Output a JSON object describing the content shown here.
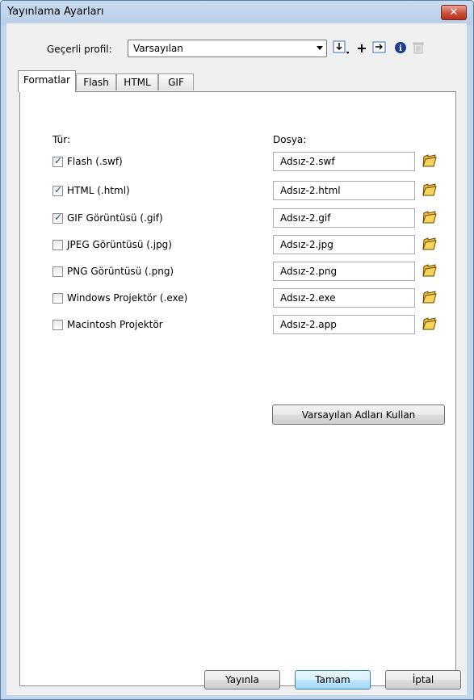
{
  "window": {
    "title": "Yayınlama Ayarları"
  },
  "profile": {
    "label": "Geçerli profil:",
    "selected": "Varsayılan",
    "toolbar_icons": [
      "import-export-icon",
      "add-icon",
      "duplicate-icon",
      "info-icon",
      "delete-icon"
    ]
  },
  "tabs": [
    {
      "label": "Formatlar",
      "active": true
    },
    {
      "label": "Flash",
      "active": false
    },
    {
      "label": "HTML",
      "active": false
    },
    {
      "label": "GIF",
      "active": false
    }
  ],
  "formats": {
    "type_header": "Tür:",
    "file_header": "Dosya:",
    "rows": [
      {
        "label": "Flash  (.swf)",
        "checked": true,
        "file": "Adsız-2.swf"
      },
      {
        "label": "HTML (.html)",
        "checked": true,
        "file": "Adsız-2.html"
      },
      {
        "label": "GIF Görüntüsü (.gif)",
        "checked": true,
        "file": "Adsız-2.gif"
      },
      {
        "label": "JPEG Görüntüsü (.jpg)",
        "checked": false,
        "file": "Adsız-2.jpg"
      },
      {
        "label": "PNG Görüntüsü (.png)",
        "checked": false,
        "file": "Adsız-2.png"
      },
      {
        "label": "Windows Projektör (.exe)",
        "checked": false,
        "file": "Adsız-2.exe"
      },
      {
        "label": "Macintosh Projektör",
        "checked": false,
        "file": "Adsız-2.app"
      }
    ],
    "defaults_button": "Varsayılan Adları Kullan"
  },
  "buttons": {
    "publish": "Yayınla",
    "ok": "Tamam",
    "cancel": "İptal"
  },
  "colors": {
    "titlebar": "#b9cfe8",
    "close": "#c9503b",
    "folder": "#f0c040",
    "check": "#2a4d8c"
  }
}
